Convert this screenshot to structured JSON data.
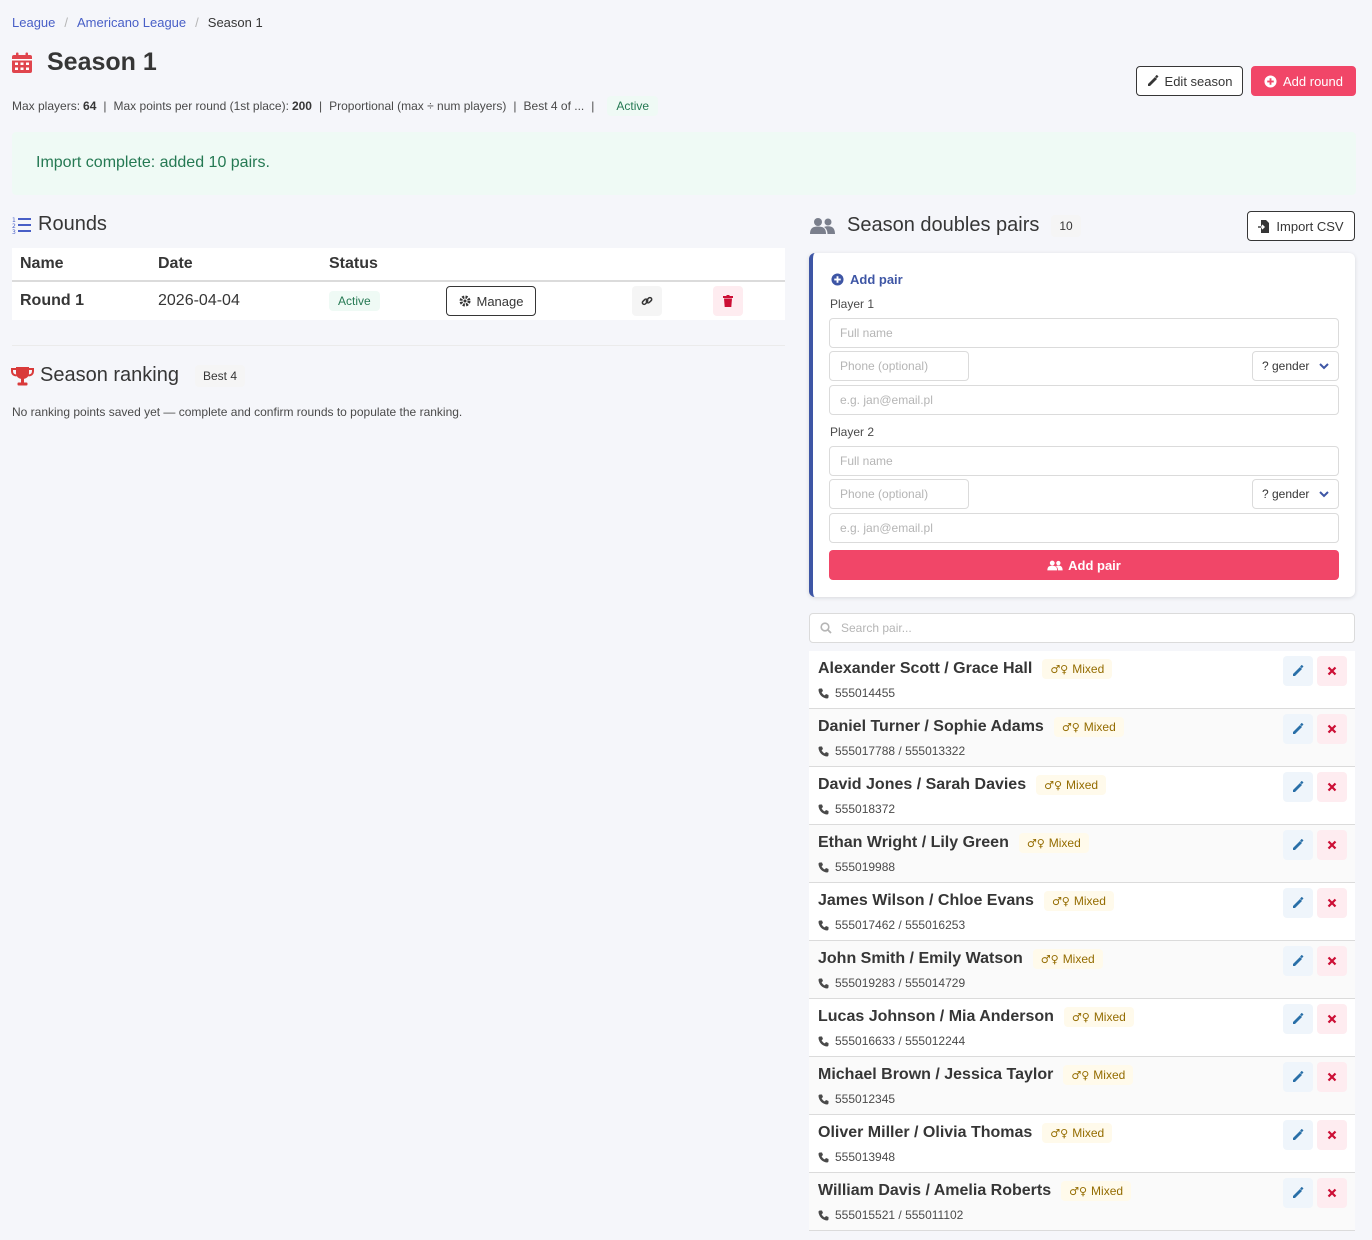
{
  "breadcrumb": {
    "items": [
      "League",
      "Americano League"
    ],
    "current": "Season 1"
  },
  "page": {
    "title": "Season 1"
  },
  "meta": {
    "max_players_label": "Max players:",
    "max_players": "64",
    "max_points_label": "Max points per round (1st place):",
    "max_points": "200",
    "scoring": "Proportional (max ÷ num players)",
    "best_of": "Best 4 of ...",
    "status": "Active"
  },
  "actions": {
    "edit_season": "Edit season",
    "add_round": "Add round"
  },
  "notification": "Import complete: added 10 pairs.",
  "rounds": {
    "title": "Rounds",
    "headers": [
      "Name",
      "Date",
      "Status"
    ],
    "rows": [
      {
        "name": "Round 1",
        "date": "2026-04-04",
        "status": "Active",
        "manage": "Manage"
      }
    ]
  },
  "ranking": {
    "title": "Season ranking",
    "tag": "Best 4",
    "note": "No ranking points saved yet — complete and confirm rounds to populate the ranking."
  },
  "pairs_section": {
    "title": "Season doubles pairs",
    "count": "10",
    "import_csv": "Import CSV"
  },
  "add_pair_form": {
    "heading": "Add pair",
    "player1_label": "Player 1",
    "player2_label": "Player 2",
    "name_placeholder": "Full name",
    "phone_placeholder": "Phone (optional)",
    "email_placeholder": "e.g. jan@email.pl",
    "gender_value": "? gender",
    "submit": "Add pair"
  },
  "search": {
    "placeholder": "Search pair..."
  },
  "pairs": [
    {
      "name": "Alexander Scott / Grace Hall",
      "tag": "Mixed",
      "phones": "555014455"
    },
    {
      "name": "Daniel Turner / Sophie Adams",
      "tag": "Mixed",
      "phones": "555017788 / 555013322"
    },
    {
      "name": "David Jones / Sarah Davies",
      "tag": "Mixed",
      "phones": "555018372"
    },
    {
      "name": "Ethan Wright / Lily Green",
      "tag": "Mixed",
      "phones": "555019988"
    },
    {
      "name": "James Wilson / Chloe Evans",
      "tag": "Mixed",
      "phones": "555017462 / 555016253"
    },
    {
      "name": "John Smith / Emily Watson",
      "tag": "Mixed",
      "phones": "555019283 / 555014729"
    },
    {
      "name": "Lucas Johnson / Mia Anderson",
      "tag": "Mixed",
      "phones": "555016633 / 555012244"
    },
    {
      "name": "Michael Brown / Jessica Taylor",
      "tag": "Mixed",
      "phones": "555012345"
    },
    {
      "name": "Oliver Miller / Olivia Thomas",
      "tag": "Mixed",
      "phones": "555013948"
    },
    {
      "name": "William Davis / Amelia Roberts",
      "tag": "Mixed",
      "phones": "555015521 / 555011102"
    }
  ],
  "colors": {
    "primary_danger": "#f14668",
    "link": "#485fc7",
    "success": "#257953",
    "accent_blue": "#3e56a5"
  },
  "icons": {
    "title": "calendar-icon",
    "rounds": "list-icon",
    "ranking": "trophy-icon",
    "pairs": "users-icon",
    "edit": "pencil-icon",
    "add": "plus-circle-icon",
    "import": "file-import-icon",
    "manage": "gear-icon",
    "link": "link-icon",
    "delete": "trash-icon",
    "search": "search-icon",
    "phone": "phone-icon",
    "remove": "close-icon",
    "mixed": "gender-mixed-icon"
  }
}
